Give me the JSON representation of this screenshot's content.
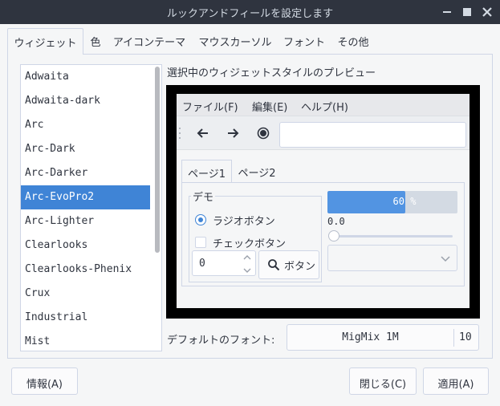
{
  "window": {
    "title": "ルックアンドフィールを設定します"
  },
  "tabs": [
    "ウィジェット",
    "色",
    "アイコンテーマ",
    "マウスカーソル",
    "フォント",
    "その他"
  ],
  "themes": {
    "items": [
      "Adwaita",
      "Adwaita-dark",
      "Arc",
      "Arc-Dark",
      "Arc-Darker",
      "Arc-EvoPro2",
      "Arc-Lighter",
      "Clearlooks",
      "Clearlooks-Phenix",
      "Crux",
      "Industrial",
      "Mist"
    ],
    "selected": "Arc-EvoPro2"
  },
  "preview": {
    "label": "選択中のウィジェットスタイルのプレビュー",
    "menu": [
      "ファイル(F)",
      "編集(E)",
      "ヘルプ(H)"
    ],
    "toolbar_icons": [
      "back-arrow-icon",
      "forward-arrow-icon",
      "record-icon"
    ],
    "tabs": [
      "ページ1",
      "ページ2"
    ],
    "demo": {
      "title": "デモ",
      "radio_label": "ラジオボタン",
      "check_label": "チェックボタン",
      "spin_value": "0",
      "search_button": "ボタン"
    },
    "progress": {
      "fraction": 0.6,
      "text": "60 %"
    },
    "scale_value": "0.0"
  },
  "default_font": {
    "label": "デフォルトのフォント:",
    "name": "MigMix 1M",
    "size": "10"
  },
  "buttons": {
    "about": "情報(A)",
    "close": "閉じる(C)",
    "apply": "適用(A)"
  },
  "colors": {
    "accent": "#3f84d6",
    "titlebar": "#2f343f",
    "progress": "#5294e2"
  }
}
